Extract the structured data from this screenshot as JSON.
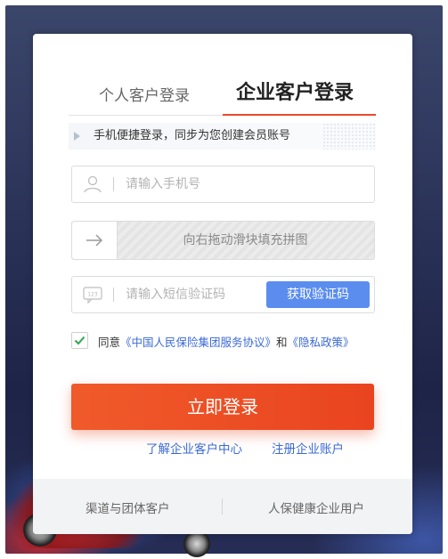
{
  "tabs": {
    "personal": "个人客户登录",
    "enterprise": "企业客户登录"
  },
  "notice": "手机便捷登录，同步为您创建会员账号",
  "phone": {
    "placeholder": "请输入手机号",
    "icon": "user-icon"
  },
  "slider": {
    "label": "向右拖动滑块填充拼图",
    "icon": "arrow-right-icon"
  },
  "sms": {
    "placeholder": "请输入短信验证码",
    "icon": "sms-code-icon",
    "get_code": "获取验证码"
  },
  "agreement": {
    "checked": true,
    "prefix": "同意",
    "link1": "《中国人民保险集团服务协议》",
    "and": "和",
    "link2": "《隐私政策》"
  },
  "login_button": "立即登录",
  "links": {
    "learn_more": "了解企业客户中心",
    "register": "注册企业账户"
  },
  "footer": {
    "channel": "渠道与团体客户",
    "health": "人保健康企业用户"
  },
  "colors": {
    "accent": "#e84a2a",
    "link": "#3b6ad6",
    "get_code_bg": "#5b8def"
  }
}
